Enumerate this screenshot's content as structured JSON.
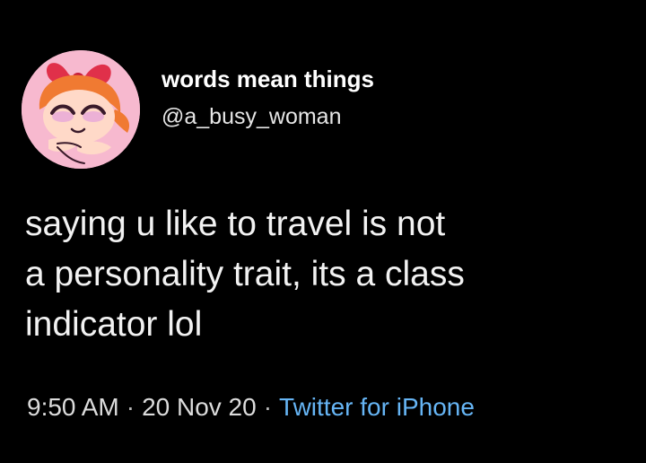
{
  "tweet": {
    "author": {
      "display_name": "words mean things",
      "handle": "@a_busy_woman",
      "avatar_icon": "powerpuff-girl-avatar-icon"
    },
    "text_lines": [
      "saying u like to travel is not",
      "a personality trait, its a class",
      "indicator lol"
    ],
    "meta": {
      "time": "9:50 AM",
      "separator": "·",
      "date": "20 Nov 20",
      "source": "Twitter for iPhone"
    }
  },
  "colors": {
    "background": "#000000",
    "text": "#f2f2f2",
    "link": "#66b5f5",
    "avatar_bg": "#f7b9cf"
  }
}
